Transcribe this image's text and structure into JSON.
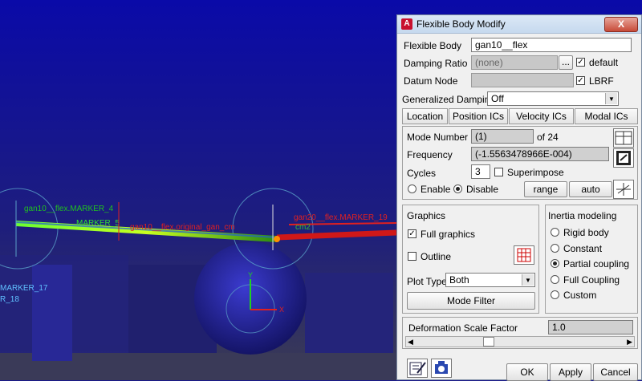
{
  "viewport": {
    "labels": {
      "marker4": "gan10__flex.MARKER_4",
      "marker5": "MARKER_5",
      "cm": "gan10__flex.original_gan_cm",
      "marker19": "gan20__flex.MARKER_19",
      "cm2": "cm2",
      "marker17": "MARKER_17",
      "marker18": "R_18",
      "ax_y": "Y",
      "ax_x": "X"
    }
  },
  "dialog": {
    "title": "Flexible Body Modify",
    "app_icon": "A",
    "close": "X",
    "flexible_body_label": "Flexible Body",
    "flexible_body_value": "gan10__flex",
    "damping_ratio_label": "Damping Ratio",
    "damping_ratio_placeholder": "(none)",
    "ellipsis": "...",
    "default_label": "default",
    "datum_node_label": "Datum Node",
    "lbrf_label": "LBRF",
    "generalized_damping_label": "Generalized Damping",
    "generalized_damping_value": "Off",
    "tabs": [
      "Location",
      "Position ICs",
      "Velocity ICs",
      "Modal ICs"
    ],
    "mode_number_label": "Mode Number",
    "mode_number_value": "(1)",
    "mode_of": "of 24",
    "frequency_label": "Frequency",
    "frequency_value": "(-1.5563478966E-004)",
    "cycles_label": "Cycles",
    "cycles_value": "3",
    "superimpose_label": "Superimpose",
    "enable_label": "Enable",
    "disable_label": "Disable",
    "range_label": "range",
    "auto_label": "auto",
    "graphics_title": "Graphics",
    "full_graphics_label": "Full graphics",
    "outline_label": "Outline",
    "plot_type_label": "Plot Type",
    "plot_type_value": "Both",
    "mode_filter_label": "Mode Filter",
    "inertia_title": "Inertia modeling",
    "inertia_options": [
      "Rigid body",
      "Constant",
      "Partial coupling",
      "Full Coupling",
      "Custom"
    ],
    "deformation_label": "Deformation Scale Factor",
    "deformation_value": "1.0",
    "ok_label": "OK",
    "apply_label": "Apply",
    "cancel_label": "Cancel",
    "check_mark": "✓"
  }
}
